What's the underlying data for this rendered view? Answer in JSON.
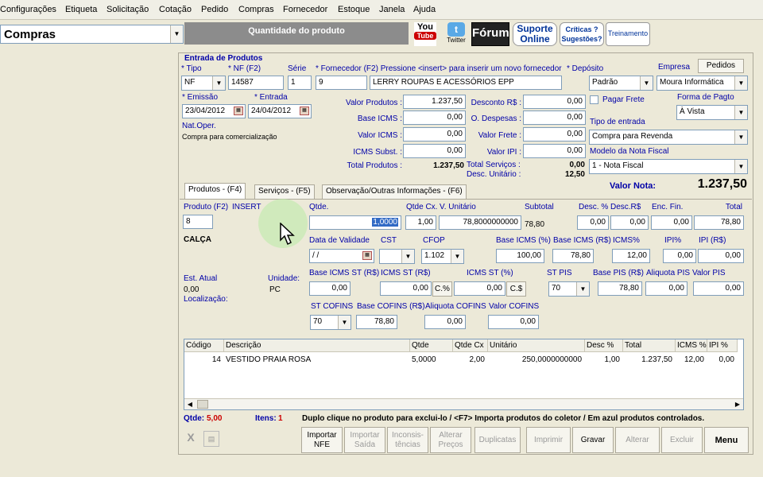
{
  "menu": [
    "Configurações",
    "Etiqueta",
    "Solicitação",
    "Cotação",
    "Pedido",
    "Compras",
    "Fornecedor",
    "Estoque",
    "Janela",
    "Ajuda"
  ],
  "module_selector": "Compras",
  "title_bar": "Quantidade do produto",
  "external": {
    "youtube_line1": "You",
    "youtube_line2": "Tube",
    "twitter": "Twitter",
    "forum": "Fórum",
    "suporte_line1": "Suporte",
    "suporte_line2": "Online",
    "criticas_line1": "Críticas ?",
    "criticas_line2": "Sugestões?",
    "treinamento": "Treinamento"
  },
  "entrada": {
    "group_title": "Entrada de Produtos",
    "tipo_label": "* Tipo",
    "tipo_value": "NF",
    "nf_label": "* NF (F2)",
    "nf_value": "14587",
    "serie_label": "Série",
    "serie_value": "1",
    "fornecedor_label": "* Fornecedor (F2) Pressione <insert> para inserir um novo fornecedor",
    "fornecedor_code": "9",
    "fornecedor_name": "LERRY ROUPAS E ACESSÓRIOS EPP",
    "deposito_label": "* Depósito",
    "deposito_value": "Padrão",
    "empresa_label": "Empresa",
    "pedidos_label": "Pedidos",
    "empresa_value": "Moura Informática",
    "emissao_label": "* Emissão",
    "emissao_value": "23/04/2012",
    "entrada_label": "* Entrada",
    "entrada_value": "24/04/2012",
    "nat_oper_label": "Nat.Oper.",
    "nat_oper_value": "Compra para comercialização",
    "valor_produtos_label": "Valor Produtos :",
    "valor_produtos": "1.237,50",
    "base_icms_label": "Base ICMS :",
    "base_icms": "0,00",
    "valor_icms_label": "Valor ICMS :",
    "valor_icms": "0,00",
    "icms_subst_label": "ICMS Subst. :",
    "icms_subst": "0,00",
    "total_produtos_label": "Total Produtos :",
    "total_produtos": "1.237,50",
    "desconto_label": "Desconto R$ :",
    "desconto": "0,00",
    "despesas_label": "O. Despesas :",
    "despesas": "0,00",
    "valor_frete_label": "Valor Frete :",
    "valor_frete": "0,00",
    "valor_ipi_label": "Valor IPI :",
    "valor_ipi": "0,00",
    "total_servicos_label": "Total Serviços :",
    "total_servicos": "0,00",
    "desc_unitario_label": "Desc. Unitário :",
    "desc_unitario": "12,50",
    "pagar_frete_label": "Pagar Frete",
    "forma_pagto_label": "Forma de Pagto",
    "forma_pagto_value": "À Vista",
    "tipo_entrada_label": "Tipo de entrada",
    "tipo_entrada_value": "Compra para Revenda",
    "modelo_nf_label": "Modelo da Nota Fiscal",
    "modelo_nf_value": "1 - Nota Fiscal",
    "valor_nota_label": "Valor Nota:",
    "valor_nota": "1.237,50"
  },
  "tabs": [
    "Produtos - (F4)",
    "Serviços - (F5)",
    "Observação/Outras Informações - (F6)"
  ],
  "produto": {
    "produto_label": "Produto (F2)",
    "insert_label": "INSERT",
    "produto_code": "8",
    "produto_name": "CALÇA",
    "qtde_label": "Qtde.",
    "qtde_value": "1,0000",
    "qtde_cx_label": "Qtde Cx.",
    "qtde_cx_value": "1,00",
    "v_unitario_label": "V. Unitário",
    "v_unitario_value": "78,8000000000",
    "subtotal_label": "Subtotal",
    "subtotal_value": "78,80",
    "desc_pct_label": "Desc. %",
    "desc_pct_value": "0,00",
    "desc_rs_label": "Desc.R$",
    "desc_rs_value": "0,00",
    "enc_fin_label": "Enc. Fin.",
    "enc_fin_value": "0,00",
    "total_label": "Total",
    "total_value": "78,80",
    "validade_label": "Data de Validade",
    "validade_value": " / /",
    "cst_label": "CST",
    "cfop_label": "CFOP",
    "cfop_value": "1.102",
    "base_icms_pct_label": "Base ICMS (%)",
    "base_icms_pct_value": "100,00",
    "base_icms_rs_label": "Base ICMS (R$)",
    "base_icms_rs_value": "78,80",
    "icms_pct_label": "ICMS%",
    "icms_pct_value": "12,00",
    "ipi_pct_label": "IPI%",
    "ipi_pct_value": "0,00",
    "ipi_rs_label": "IPI (R$)",
    "ipi_rs_value": "0,00",
    "est_atual_label": "Est. Atual",
    "est_atual_value": "0,00",
    "unidade_label": "Unidade:",
    "unidade_value": "PC",
    "localizacao_label": "Localização:",
    "base_icms_st_label": "Base ICMS ST (R$)",
    "base_icms_st_value": "0,00",
    "icms_st_rs_label": "ICMS ST (R$)",
    "icms_st_rs_value": "0,00",
    "c_pct_btn": "C.%",
    "icms_st_pct_label": "ICMS ST (%)",
    "icms_st_pct_value": "0,00",
    "c_s_btn": "C.$",
    "st_pis_label": "ST PIS",
    "st_pis_value": "70",
    "base_pis_label": "Base PIS (R$)",
    "base_pis_value": "78,80",
    "aliq_pis_label": "Aliquota PIS",
    "aliq_pis_value": "0,00",
    "valor_pis_label": "Valor PIS",
    "valor_pis_value": "0,00",
    "st_cofins_label": "ST COFINS",
    "st_cofins_value": "70",
    "base_cofins_label": "Base COFINS (R$)",
    "base_cofins_value": "78,80",
    "aliq_cofins_label": "Aliquota COFINS",
    "aliq_cofins_value": "0,00",
    "valor_cofins_label": "Valor COFINS",
    "valor_cofins_value": "0,00"
  },
  "grid": {
    "columns": [
      "Código",
      "Descrição",
      "Qtde",
      "Qtde Cx",
      "Unitário",
      "Desc %",
      "Total",
      "ICMS %",
      "IPI %"
    ],
    "rows": [
      [
        "14",
        "VESTIDO PRAIA ROSA",
        "5,0000",
        "2,00",
        "250,0000000000",
        "1,00",
        "1.237,50",
        "12,00",
        "0,00"
      ]
    ]
  },
  "status": {
    "qtde_label": "Qtde:",
    "qtde_value": "5,00",
    "itens_label": "Itens:",
    "itens_value": "1",
    "hint": "Duplo clique no produto para exclui-lo   / <F7> Importa produtos do coletor   / Em azul produtos controlados."
  },
  "buttons": {
    "importar_nfe_1": "Importar",
    "importar_nfe_2": "NFE",
    "importar_saida_1": "Importar",
    "importar_saida_2": "Saída",
    "inconsistencias_1": "Inconsis-",
    "inconsistencias_2": "tências",
    "alterar_precos_1": "Alterar",
    "alterar_precos_2": "Preços",
    "duplicatas": "Duplicatas",
    "imprimir": "Imprimir",
    "gravar": "Gravar",
    "alterar": "Alterar",
    "excluir": "Excluir",
    "menu": "Menu"
  },
  "colors": {
    "label_blue": "#0000a8",
    "accent_red": "#cc0000",
    "title_gray": "#8c8c8c"
  }
}
